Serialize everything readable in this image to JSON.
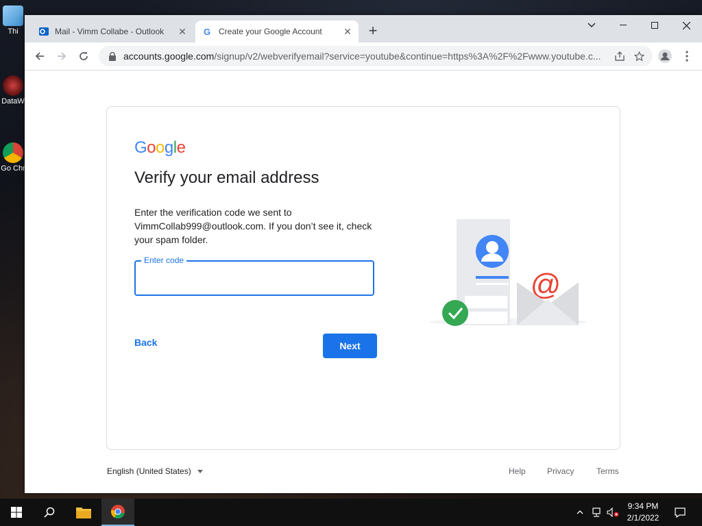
{
  "desktop": {
    "icons": [
      {
        "label": "Thi"
      },
      {
        "label": "DataW"
      },
      {
        "label": "Go Chr"
      }
    ]
  },
  "browser": {
    "tabs": [
      {
        "title": "Mail - Vimm Collabe - Outlook",
        "icon": "outlook-icon",
        "active": false
      },
      {
        "title": "Create your Google Account",
        "icon": "google-icon",
        "active": true
      }
    ],
    "url_host": "accounts.google.com",
    "url_path": "/signup/v2/webverifyemail?service=youtube&continue=https%3A%2F%2Fwww.youtube.c..."
  },
  "page": {
    "logo": [
      "G",
      "o",
      "o",
      "g",
      "l",
      "e"
    ],
    "title": "Verify your email address",
    "description": "Enter the verification code we sent to VimmCollab999@outlook.com. If you don’t see it, check your spam folder.",
    "code_field": {
      "label": "Enter code",
      "value": ""
    },
    "back_label": "Back",
    "next_label": "Next",
    "illustration_symbol": "@",
    "colors": {
      "primary": "#1a73e8",
      "check_green": "#34a853",
      "mail_red": "#ea4335"
    }
  },
  "footer": {
    "language": "English (United States)",
    "links": {
      "help": "Help",
      "privacy": "Privacy",
      "terms": "Terms"
    }
  },
  "taskbar": {
    "time": "9:34 PM",
    "date": "2/1/2022"
  }
}
